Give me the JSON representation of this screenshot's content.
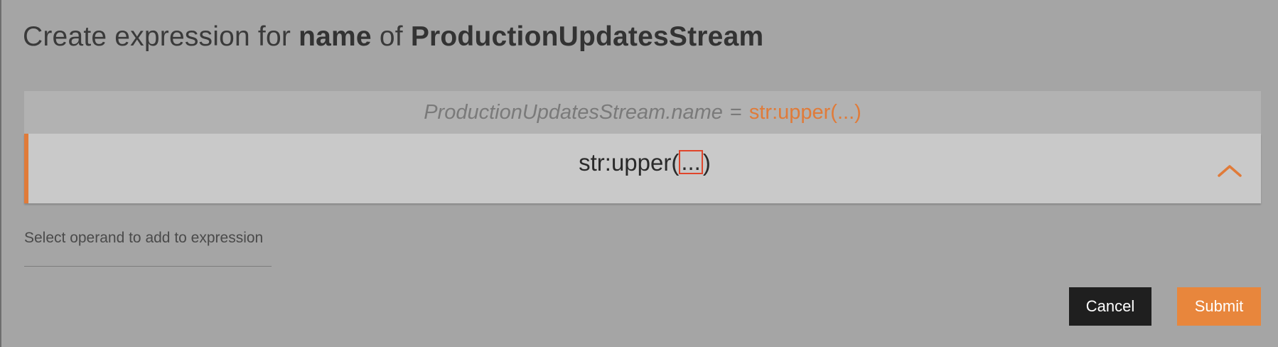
{
  "dialog": {
    "title_prefix": "Create expression for",
    "title_attribute": "name",
    "title_of": "of",
    "title_stream": "ProductionUpdatesStream"
  },
  "preview": {
    "lhs": "ProductionUpdatesStream.name",
    "eq": "=",
    "rhs": "str:upper(...)"
  },
  "expression": {
    "function": "str:upper(",
    "operand": "...",
    "close": ")"
  },
  "operand_select": {
    "placeholder": "Select operand to add to expression"
  },
  "actions": {
    "cancel_label": "Cancel",
    "submit_label": "Submit"
  },
  "colors": {
    "accent": "#e07b39",
    "operand_highlight": "#e0452b",
    "cancel_bg": "#1f1f1f",
    "submit_bg": "#e8863c",
    "overlay_bg": "#a5a5a5"
  },
  "icons": {
    "collapse": "chevron-up-icon"
  }
}
